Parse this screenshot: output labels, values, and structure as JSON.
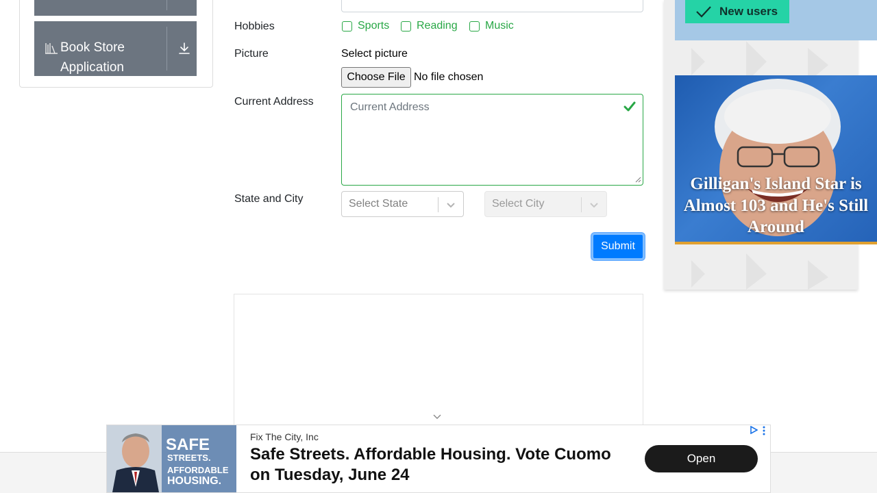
{
  "sidebar": {
    "items": [
      {
        "label": ""
      },
      {
        "label": "Book Store Application"
      }
    ]
  },
  "form": {
    "hobbies_label": "Hobbies",
    "hobbies": [
      "Sports",
      "Reading",
      "Music"
    ],
    "picture_label": "Picture",
    "picture_caption": "Select picture",
    "file_button": "Choose File",
    "file_status": "No file chosen",
    "address_label": "Current Address",
    "address_placeholder": "Current Address",
    "state_city_label": "State and City",
    "state_placeholder": "Select State",
    "city_placeholder": "Select City",
    "submit_label": "Submit"
  },
  "right_ad": {
    "badge": "New users",
    "caption": "Gilligan's Island Star is Almost 103 and He's Still Around"
  },
  "bottom_ad": {
    "advertiser": "Fix The City, Inc",
    "headline": "Safe Streets. Affordable Housing. Vote Cuomo on Tuesday, June 24",
    "cta": "Open",
    "image_text": [
      "SAFE",
      "STREETS.",
      "AFFORDABLE",
      "HOUSING."
    ]
  },
  "colors": {
    "success": "#28a745",
    "primary": "#007bff",
    "sidebar_item": "#6c7580",
    "badge": "#25d3a6"
  }
}
